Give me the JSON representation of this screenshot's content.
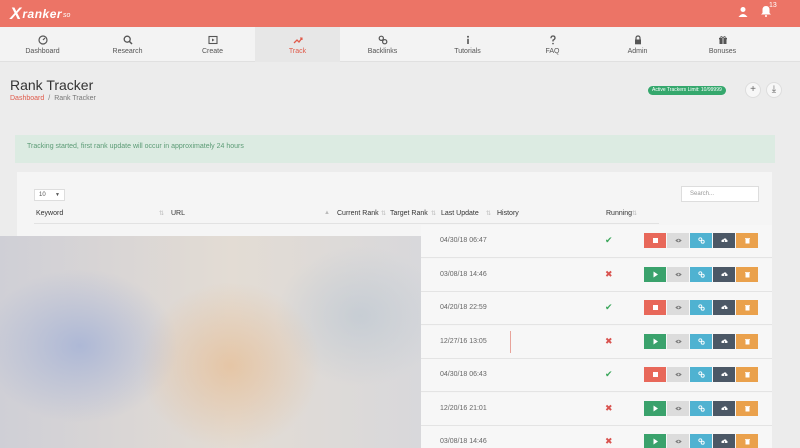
{
  "app": {
    "logo_x": "X",
    "logo_text": "ranker",
    "logo_sub": "so",
    "notification_count": "13"
  },
  "nav": [
    {
      "label": "Dashboard",
      "icon": "dashboard-icon"
    },
    {
      "label": "Research",
      "icon": "search-icon"
    },
    {
      "label": "Create",
      "icon": "play-square-icon"
    },
    {
      "label": "Track",
      "icon": "trend-icon",
      "active": true
    },
    {
      "label": "Backlinks",
      "icon": "link-icon"
    },
    {
      "label": "Tutorials",
      "icon": "info-icon"
    },
    {
      "label": "FAQ",
      "icon": "question-icon"
    },
    {
      "label": "Admin",
      "icon": "lock-icon"
    },
    {
      "label": "Bonuses",
      "icon": "gift-icon"
    }
  ],
  "page": {
    "title": "Rank Tracker",
    "breadcrumb_home": "Dashboard",
    "breadcrumb_sep": "/",
    "breadcrumb_current": "Rank Tracker",
    "limit_badge": "Active Trackers Limit: 10/99999",
    "add_label": "+",
    "download_label": "⤓"
  },
  "alert": {
    "text": "Tracking started, first rank update will occur in approximately 24 hours"
  },
  "table": {
    "page_length": "10",
    "search_placeholder": "Search...",
    "columns": [
      "Keyword",
      "URL",
      "Current Rank",
      "Target Rank",
      "Last Update",
      "History",
      "Running"
    ],
    "rows": [
      {
        "last_update": "04/30/18 06:47",
        "running": true
      },
      {
        "last_update": "03/08/18 14:46",
        "running": false
      },
      {
        "last_update": "04/20/18 22:59",
        "running": true
      },
      {
        "last_update": "12/27/16 13:05",
        "running": false
      },
      {
        "last_update": "04/30/18 06:43",
        "running": true
      },
      {
        "last_update": "12/20/16 21:01",
        "running": false
      },
      {
        "last_update": "03/08/18 14:46",
        "running": false
      }
    ]
  },
  "colors": {
    "brand": "#ec7466",
    "success": "#35a86d",
    "danger": "#e8685a",
    "info": "#4fb2d1",
    "warning": "#eaa14c",
    "dark": "#4c5866"
  }
}
